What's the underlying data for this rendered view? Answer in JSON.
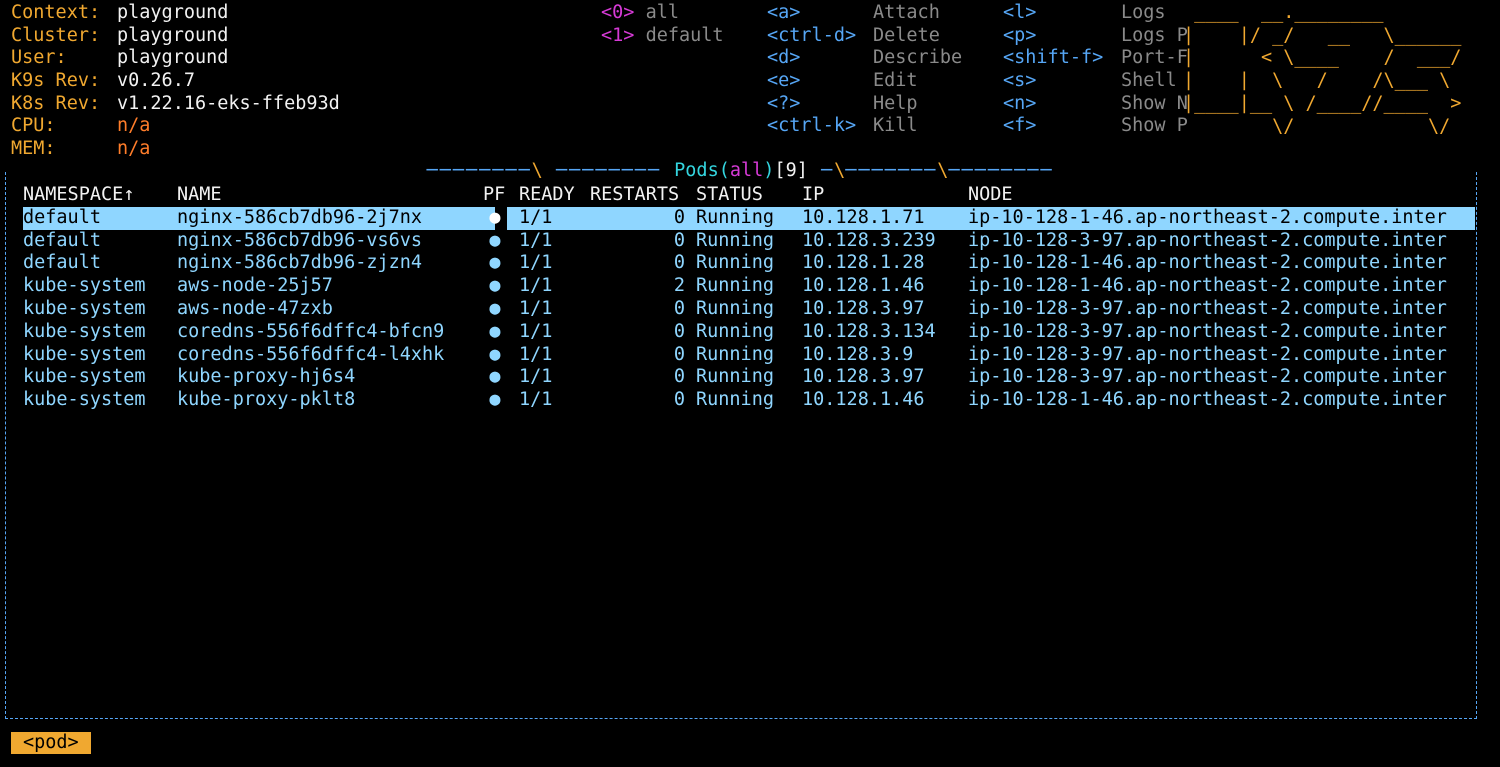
{
  "info": [
    {
      "key": "Context:",
      "value": "playground",
      "value_color": "white"
    },
    {
      "key": "Cluster:",
      "value": "playground",
      "value_color": "white"
    },
    {
      "key": "User:",
      "value": "playground",
      "value_color": "white"
    },
    {
      "key": "K9s Rev:",
      "value": "v0.26.7",
      "value_color": "white"
    },
    {
      "key": "K8s Rev:",
      "value": "v1.22.16-eks-ffeb93d",
      "value_color": "white"
    },
    {
      "key": "CPU:",
      "value": "n/a",
      "value_color": "red-orange"
    },
    {
      "key": "MEM:",
      "value": "n/a",
      "value_color": "red-orange"
    }
  ],
  "namespaces": [
    {
      "key": "<0>",
      "label": "all"
    },
    {
      "key": "<1>",
      "label": "default"
    }
  ],
  "hotkeys_col1": [
    {
      "key": "<a>",
      "label": "Attach"
    },
    {
      "key": "<ctrl-d>",
      "label": "Delete"
    },
    {
      "key": "<d>",
      "label": "Describe"
    },
    {
      "key": "<e>",
      "label": "Edit"
    },
    {
      "key": "<?>",
      "label": "Help"
    },
    {
      "key": "<ctrl-k>",
      "label": "Kill"
    }
  ],
  "hotkeys_col2": [
    {
      "key": "<l>",
      "label": "Logs"
    },
    {
      "key": "<p>",
      "label": "Logs P"
    },
    {
      "key": "<shift-f>",
      "label": "Port-F"
    },
    {
      "key": "<s>",
      "label": "Shell"
    },
    {
      "key": "<n>",
      "label": "Show N"
    },
    {
      "key": "<f>",
      "label": "Show P"
    }
  ],
  "logo_lines": [
    " ____  __.________       ",
    "|    |/ _/   __   \\______",
    "|      < \\____    /  ___/",
    "|    |  \\   /    /\\___ \\ ",
    "|____|__ \\ /____//____  >",
    "        \\/            \\/ "
  ],
  "table": {
    "title_resource": "Pods",
    "title_scope": "all",
    "title_count": "9",
    "headers": {
      "namespace": "NAMESPACE↑",
      "name": "NAME",
      "pf": "PF",
      "ready": "READY",
      "restarts": "RESTARTS",
      "status": "STATUS",
      "ip": "IP",
      "node": "NODE"
    },
    "rows": [
      {
        "namespace": "default",
        "name": "nginx-586cb7db96-2j7nx",
        "pf": "●",
        "ready": "1/1",
        "restarts": "0",
        "status": "Running",
        "ip": "10.128.1.71",
        "node": "ip-10-128-1-46.ap-northeast-2.compute.inter",
        "selected": true
      },
      {
        "namespace": "default",
        "name": "nginx-586cb7db96-vs6vs",
        "pf": "●",
        "ready": "1/1",
        "restarts": "0",
        "status": "Running",
        "ip": "10.128.3.239",
        "node": "ip-10-128-3-97.ap-northeast-2.compute.inter"
      },
      {
        "namespace": "default",
        "name": "nginx-586cb7db96-zjzn4",
        "pf": "●",
        "ready": "1/1",
        "restarts": "0",
        "status": "Running",
        "ip": "10.128.1.28",
        "node": "ip-10-128-1-46.ap-northeast-2.compute.inter"
      },
      {
        "namespace": "kube-system",
        "name": "aws-node-25j57",
        "pf": "●",
        "ready": "1/1",
        "restarts": "2",
        "status": "Running",
        "ip": "10.128.1.46",
        "node": "ip-10-128-1-46.ap-northeast-2.compute.inter"
      },
      {
        "namespace": "kube-system",
        "name": "aws-node-47zxb",
        "pf": "●",
        "ready": "1/1",
        "restarts": "0",
        "status": "Running",
        "ip": "10.128.3.97",
        "node": "ip-10-128-3-97.ap-northeast-2.compute.inter"
      },
      {
        "namespace": "kube-system",
        "name": "coredns-556f6dffc4-bfcn9",
        "pf": "●",
        "ready": "1/1",
        "restarts": "0",
        "status": "Running",
        "ip": "10.128.3.134",
        "node": "ip-10-128-3-97.ap-northeast-2.compute.inter"
      },
      {
        "namespace": "kube-system",
        "name": "coredns-556f6dffc4-l4xhk",
        "pf": "●",
        "ready": "1/1",
        "restarts": "0",
        "status": "Running",
        "ip": "10.128.3.9",
        "node": "ip-10-128-3-97.ap-northeast-2.compute.inter"
      },
      {
        "namespace": "kube-system",
        "name": "kube-proxy-hj6s4",
        "pf": "●",
        "ready": "1/1",
        "restarts": "0",
        "status": "Running",
        "ip": "10.128.3.97",
        "node": "ip-10-128-3-97.ap-northeast-2.compute.inter"
      },
      {
        "namespace": "kube-system",
        "name": "kube-proxy-pklt8",
        "pf": "●",
        "ready": "1/1",
        "restarts": "0",
        "status": "Running",
        "ip": "10.128.1.46",
        "node": "ip-10-128-1-46.ap-northeast-2.compute.inter"
      }
    ]
  },
  "breadcrumb": "<pod>",
  "colors": {
    "accent": "#f0a830",
    "key": "#56a6f5",
    "namespace_key": "#d63ad6",
    "row": "#8fd6ff",
    "title": "#34d6e0",
    "background": "#000000"
  }
}
